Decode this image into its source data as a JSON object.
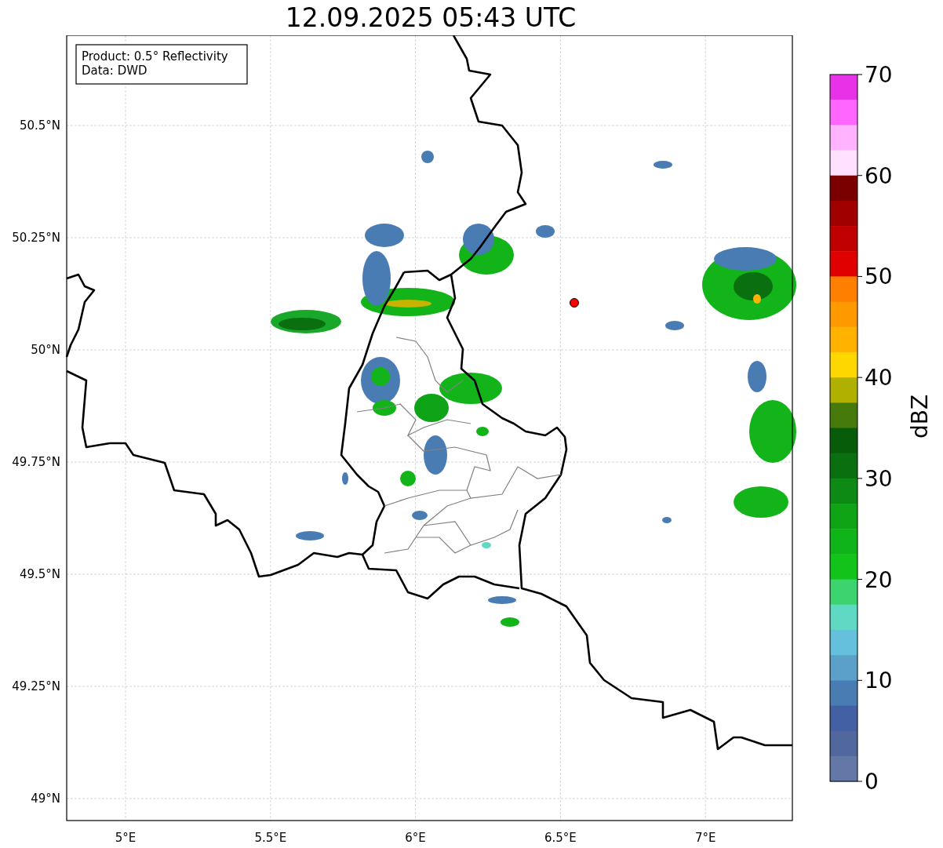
{
  "title": "12.09.2025 05:43 UTC",
  "map": {
    "info_box": [
      "Product: 0.5° Reflectivity",
      "Data: DWD"
    ],
    "lat_ticks": [
      "50.5°N",
      "50.25°N",
      "50°N",
      "49.75°N",
      "49.5°N",
      "49.25°N",
      "49°N"
    ],
    "lon_ticks": [
      "5°E",
      "5.5°E",
      "6°E",
      "6.5°E",
      "7°E"
    ]
  },
  "colorbar": {
    "label": "dBZ",
    "ticks": [
      "70",
      "60",
      "50",
      "40",
      "30",
      "20",
      "10",
      "0"
    ],
    "segments": [
      {
        "color": "#e832e8"
      },
      {
        "color": "#ff66ff"
      },
      {
        "color": "#ffb3ff"
      },
      {
        "color": "#ffe0ff"
      },
      {
        "color": "#7a0000"
      },
      {
        "color": "#a00000"
      },
      {
        "color": "#c00000"
      },
      {
        "color": "#e00000"
      },
      {
        "color": "#ff7f00"
      },
      {
        "color": "#ff9900"
      },
      {
        "color": "#ffb300"
      },
      {
        "color": "#ffd700"
      },
      {
        "color": "#b0b000"
      },
      {
        "color": "#467a0a"
      },
      {
        "color": "#075c0a"
      },
      {
        "color": "#0a700f"
      },
      {
        "color": "#0c8a14"
      },
      {
        "color": "#0ea416"
      },
      {
        "color": "#0fb418"
      },
      {
        "color": "#12c41a"
      },
      {
        "color": "#3cd46e"
      },
      {
        "color": "#5fd8c4"
      },
      {
        "color": "#64c0dc"
      },
      {
        "color": "#5aa0c8"
      },
      {
        "color": "#4a7cb4"
      },
      {
        "color": "#4460a4"
      },
      {
        "color": "#50689e"
      },
      {
        "color": "#6478a8"
      }
    ]
  }
}
